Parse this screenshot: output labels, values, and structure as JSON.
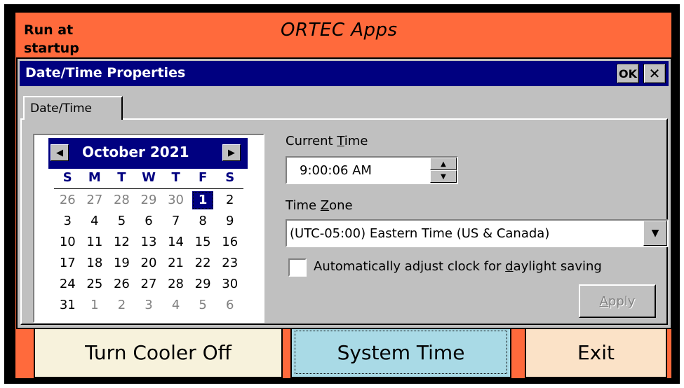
{
  "app": {
    "title": "ORTEC Apps",
    "run_at_startup": "Run at startup",
    "buttons": {
      "cooler": "Turn Cooler Off",
      "system_time": "System Time",
      "exit": "Exit"
    },
    "colors": {
      "background": "#ff6a3c",
      "cooler_btn": "#f7f2dc",
      "systime_btn": "#a9dae6",
      "exit_btn": "#fbe2c7"
    }
  },
  "dialog": {
    "title": "Date/Time Properties",
    "ok_label": "OK",
    "close_label": "✕",
    "tab": "Date/Time",
    "calendar": {
      "prev_icon": "◀",
      "next_icon": "▶",
      "month_year": "October 2021",
      "weekdays": [
        "S",
        "M",
        "T",
        "W",
        "T",
        "F",
        "S"
      ],
      "days": [
        {
          "d": "26",
          "dim": true
        },
        {
          "d": "27",
          "dim": true
        },
        {
          "d": "28",
          "dim": true
        },
        {
          "d": "29",
          "dim": true
        },
        {
          "d": "30",
          "dim": true
        },
        {
          "d": "1",
          "sel": true
        },
        {
          "d": "2"
        },
        {
          "d": "3"
        },
        {
          "d": "4"
        },
        {
          "d": "5"
        },
        {
          "d": "6"
        },
        {
          "d": "7"
        },
        {
          "d": "8"
        },
        {
          "d": "9"
        },
        {
          "d": "10"
        },
        {
          "d": "11"
        },
        {
          "d": "12"
        },
        {
          "d": "13"
        },
        {
          "d": "14"
        },
        {
          "d": "15"
        },
        {
          "d": "16"
        },
        {
          "d": "17"
        },
        {
          "d": "18"
        },
        {
          "d": "19"
        },
        {
          "d": "20"
        },
        {
          "d": "21"
        },
        {
          "d": "22"
        },
        {
          "d": "23"
        },
        {
          "d": "24"
        },
        {
          "d": "25"
        },
        {
          "d": "26"
        },
        {
          "d": "27"
        },
        {
          "d": "28"
        },
        {
          "d": "29"
        },
        {
          "d": "30"
        },
        {
          "d": "31"
        },
        {
          "d": "1",
          "dim": true
        },
        {
          "d": "2",
          "dim": true
        },
        {
          "d": "3",
          "dim": true
        },
        {
          "d": "4",
          "dim": true
        },
        {
          "d": "5",
          "dim": true
        },
        {
          "d": "6",
          "dim": true
        }
      ]
    },
    "current_time": {
      "label_pre": "Current ",
      "label_key": "T",
      "label_post": "ime",
      "value": "9:00:06 AM"
    },
    "time_zone": {
      "label_pre": "Time ",
      "label_key": "Z",
      "label_post": "one",
      "value": "(UTC-05:00) Eastern Time (US & Canada)"
    },
    "dst": {
      "label_pre": "Automatically adjust clock for ",
      "label_key": "d",
      "label_post": "aylight saving",
      "checked": false
    },
    "apply": {
      "label_key": "A",
      "label_post": "pply",
      "enabled": false
    }
  }
}
